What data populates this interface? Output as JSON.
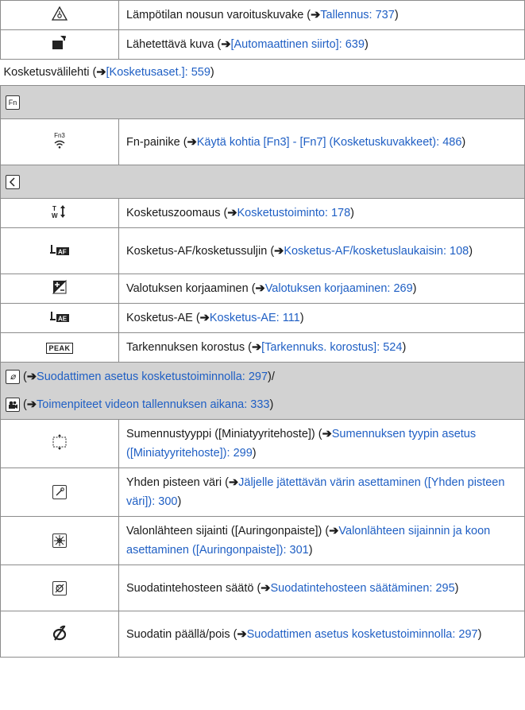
{
  "rows": [
    {
      "type": "item",
      "icon": "temperature-warning-icon",
      "text": "Lämpötilan nousun varoituskuvake (",
      "link": "Tallennus: 737",
      "tail": ")"
    },
    {
      "type": "item",
      "icon": "transfer-image-icon",
      "text": "Lähetettävä kuva (",
      "link": "[Automaattinen siirto]: 639",
      "tail": ")"
    },
    {
      "type": "note",
      "text": "Kosketusvälilehti (",
      "link": "[Kosketusaset.]: 559",
      "tail": ")"
    },
    {
      "type": "header",
      "icon": "fn-tab-icon",
      "label": "Fn"
    },
    {
      "type": "item",
      "icon": "fn3-button-icon",
      "icon_text": "Fn3",
      "text": "Fn-painike (",
      "link": "Käytä kohtia [Fn3] - [Fn7] (Kosketuskuvakkeet): 486",
      "tail": ")"
    },
    {
      "type": "header",
      "icon": "back-arrow-tab-icon"
    },
    {
      "type": "item",
      "icon": "touch-zoom-icon",
      "icon_text": "T↕W",
      "text": "Kosketuszoomaus (",
      "link": "Kosketustoiminto: 178",
      "tail": ")"
    },
    {
      "type": "item",
      "icon": "touch-af-icon",
      "icon_text": "AF",
      "text": "Kosketus-AF/kosketussuljin (",
      "link": "Kosketus-AF/kosketuslaukaisin: 108",
      "tail": ")"
    },
    {
      "type": "item",
      "icon": "exposure-compensation-icon",
      "text": "Valotuksen korjaaminen (",
      "link": "Valotuksen korjaaminen: 269",
      "tail": ")"
    },
    {
      "type": "item",
      "icon": "touch-ae-icon",
      "icon_text": "AE",
      "text": "Kosketus-AE (",
      "link": "Kosketus-AE: 111",
      "tail": ")"
    },
    {
      "type": "item",
      "icon": "peaking-icon",
      "icon_text": "PEAK",
      "text": "Tarkennuksen korostus (",
      "link": "[Tarkennuks. korostus]: 524",
      "tail": ")"
    },
    {
      "type": "header_link",
      "icon": "filter-tab-icon",
      "pre": "(",
      "link": "Suodattimen asetus kosketustoiminnolla: 297",
      "tail": ")/"
    },
    {
      "type": "header_link",
      "icon": "video-tab-icon",
      "pre": "(",
      "link": "Toimenpiteet videon tallennuksen aikana: 333",
      "tail": ")"
    },
    {
      "type": "item",
      "icon": "blur-type-icon",
      "text": "Sumennustyyppi ([Miniatyyritehoste]) (",
      "link": "Sumennuksen tyypin asetus ([Miniatyyritehoste]): 299",
      "tail": ")"
    },
    {
      "type": "item",
      "icon": "one-point-color-icon",
      "text": "Yhden pisteen väri (",
      "link": "Jäljelle jätettävän värin asettaminen ([Yhden pisteen väri]): 300",
      "tail": ")"
    },
    {
      "type": "item",
      "icon": "light-source-position-icon",
      "text": "Valonlähteen sijainti ([Auringonpaiste]) (",
      "link": "Valonlähteen sijainnin ja koon asettaminen ([Auringonpaiste]): 301",
      "tail": ")"
    },
    {
      "type": "item",
      "icon": "filter-adjust-icon",
      "text": "Suodatintehosteen säätö (",
      "link": "Suodatintehosteen säätäminen: 295",
      "tail": ")"
    },
    {
      "type": "item",
      "icon": "filter-on-off-icon",
      "text": "Suodatin päällä/pois (",
      "link": "Suodattimen asetus kosketustoiminnolla: 297",
      "tail": ")"
    }
  ],
  "arrow": "➔"
}
